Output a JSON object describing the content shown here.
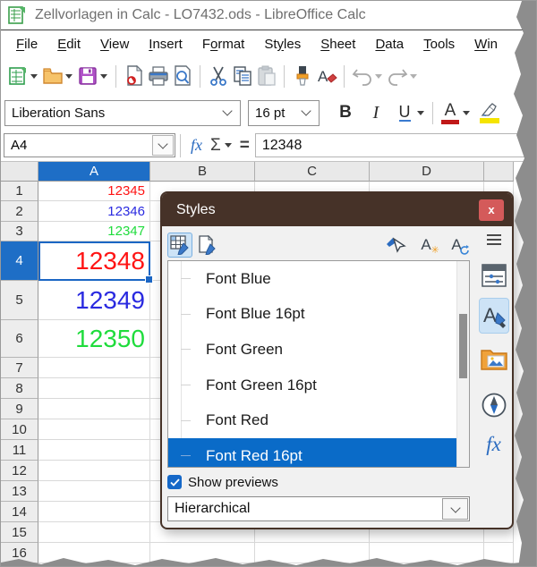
{
  "window": {
    "title": "Zellvorlagen in Calc - LO7432.ods - LibreOffice Calc"
  },
  "menubar": [
    {
      "label": "File",
      "u": 0
    },
    {
      "label": "Edit",
      "u": 0
    },
    {
      "label": "View",
      "u": 0
    },
    {
      "label": "Insert",
      "u": 0
    },
    {
      "label": "Format",
      "u": 1
    },
    {
      "label": "Styles",
      "u": 2
    },
    {
      "label": "Sheet",
      "u": 0
    },
    {
      "label": "Data",
      "u": 0
    },
    {
      "label": "Tools",
      "u": 0
    },
    {
      "label": "Win",
      "u": 0
    }
  ],
  "toolbar": {
    "icons": [
      "new-document-icon",
      "open-icon",
      "save-icon",
      "export-pdf-icon",
      "print-icon",
      "print-preview-icon",
      "cut-icon",
      "copy-icon",
      "paste-icon",
      "clone-formatting-icon",
      "clear-formatting-icon",
      "undo-icon",
      "redo-icon"
    ]
  },
  "fontbar": {
    "font_name": "Liberation Sans",
    "font_size": "16 pt",
    "bold": "B",
    "italic": "I",
    "underline": "U",
    "font_color_letter": "A"
  },
  "formulabar": {
    "cell_reference": "A4",
    "fx": "fx",
    "sigma": "Σ",
    "equals": "=",
    "content": "12348"
  },
  "grid": {
    "columns": [
      "A",
      "B",
      "C",
      "D"
    ],
    "selected_column": "A",
    "selected_row": 4,
    "row_count": 16,
    "cells": [
      {
        "row": 1,
        "value": "12345",
        "color": "#ff1414",
        "size": "small"
      },
      {
        "row": 2,
        "value": "12346",
        "color": "#2a2ae0",
        "size": "small"
      },
      {
        "row": 3,
        "value": "12347",
        "color": "#1fdc3c",
        "size": "small"
      },
      {
        "row": 4,
        "value": "12348",
        "color": "#ff1414",
        "size": "large"
      },
      {
        "row": 5,
        "value": "12349",
        "color": "#2a2ae0",
        "size": "large"
      },
      {
        "row": 6,
        "value": "12350",
        "color": "#1fdc3c",
        "size": "large"
      }
    ]
  },
  "styles_panel": {
    "title": "Styles",
    "close_label": "x",
    "toolbar_icons": [
      "cell-styles-icon",
      "page-styles-icon",
      "spotlight-icon",
      "new-style-from-selection-icon",
      "update-style-icon",
      "menu-icon"
    ],
    "icon_letter": "A",
    "new_style_mark": "✳",
    "list": [
      {
        "label": "Font Blue",
        "selected": false
      },
      {
        "label": "Font Blue 16pt",
        "selected": false
      },
      {
        "label": "Font Green",
        "selected": false
      },
      {
        "label": "Font Green 16pt",
        "selected": false
      },
      {
        "label": "Font Red",
        "selected": false
      },
      {
        "label": "Font Red 16pt",
        "selected": true
      }
    ],
    "show_previews_label": "Show previews",
    "show_previews_checked": true,
    "filter_value": "Hierarchical",
    "sidebar_tabs": [
      "sidebar-menu-icon",
      "properties-icon",
      "styles-icon",
      "gallery-icon",
      "navigator-icon",
      "functions-icon"
    ],
    "functions_label": "fx"
  },
  "colors": {
    "selection_blue": "#1e6ec6",
    "list_selection_blue": "#0a6bc8",
    "titlebar_brown": "#463228",
    "close_red": "#d45a5a",
    "font_color_red": "#c01818",
    "highlight_yellow": "#f5e400",
    "cell_red": "#ff1414",
    "cell_blue": "#2a2ae0",
    "cell_green": "#1fdc3c"
  }
}
